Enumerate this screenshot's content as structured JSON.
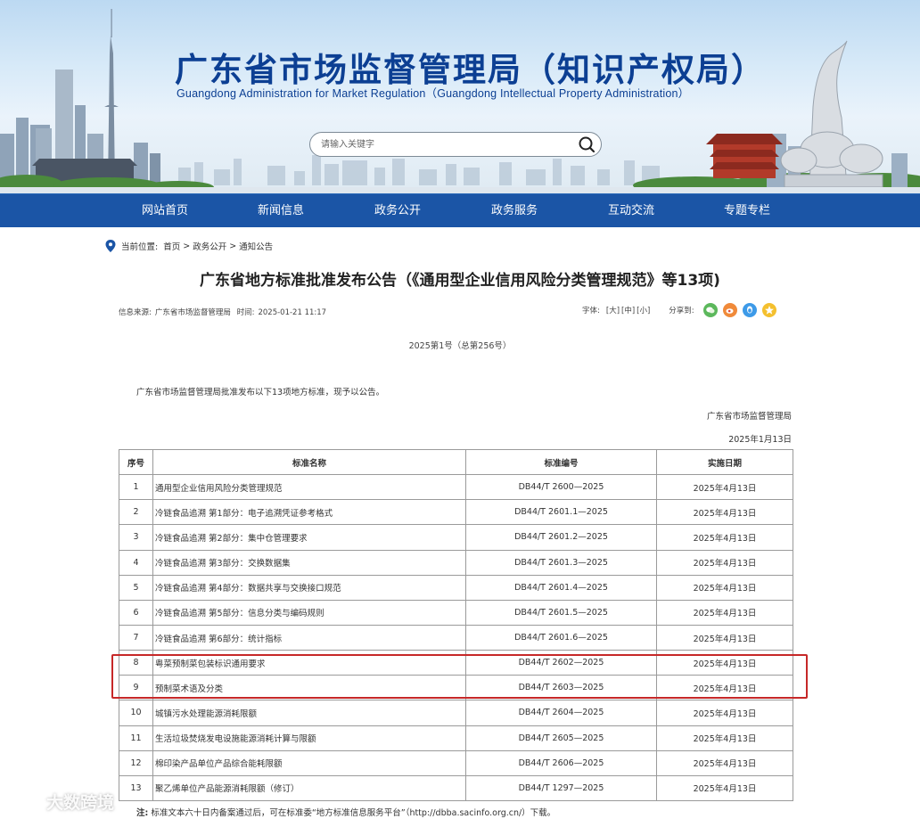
{
  "header": {
    "title": "广东省市场监督管理局（知识产权局）",
    "subtitle": "Guangdong Administration for Market Regulation（Guangdong Intellectual Property Administration）",
    "search_placeholder": "请输入关键字",
    "brand_color": "#0c3f93"
  },
  "nav": {
    "color": "#1b55a6",
    "items": [
      "网站首页",
      "新闻信息",
      "政务公开",
      "政务服务",
      "互动交流",
      "专题专栏"
    ]
  },
  "breadcrumb": {
    "label": "当前位置:",
    "items": [
      "首页",
      "政务公开",
      "通知公告"
    ],
    "separator": ">"
  },
  "article": {
    "title": "广东省地方标准批准发布公告（《通用型企业信用风险分类管理规范》等13项)",
    "source_label": "信息来源:",
    "source": "广东省市场监督管理局",
    "time_label": "时间:",
    "time": "2025-01-21 11:17",
    "font_label": "字体:",
    "font_sizes": [
      "[大]",
      "[中]",
      "[小]"
    ],
    "share_label": "分享到:",
    "share_icons": [
      "wechat-icon",
      "weibo-icon",
      "qq-icon",
      "qzone-icon"
    ],
    "doc_number": "2025第1号（总第256号）",
    "intro": "广东省市场监督管理局批准发布以下13项地方标准，现予以公告。",
    "issuer": "广东省市场监督管理局",
    "issue_date": "2025年1月13日"
  },
  "table": {
    "headers": [
      "序号",
      "标准名称",
      "标准编号",
      "实施日期"
    ],
    "rows": [
      [
        "1",
        "通用型企业信用风险分类管理规范",
        "DB44/T 2600—2025",
        "2025年4月13日"
      ],
      [
        "2",
        "冷链食品追溯 第1部分：电子追溯凭证参考格式",
        "DB44/T 2601.1—2025",
        "2025年4月13日"
      ],
      [
        "3",
        "冷链食品追溯 第2部分：集中仓管理要求",
        "DB44/T 2601.2—2025",
        "2025年4月13日"
      ],
      [
        "4",
        "冷链食品追溯 第3部分：交换数据集",
        "DB44/T 2601.3—2025",
        "2025年4月13日"
      ],
      [
        "5",
        "冷链食品追溯 第4部分：数据共享与交换接口规范",
        "DB44/T 2601.4—2025",
        "2025年4月13日"
      ],
      [
        "6",
        "冷链食品追溯 第5部分：信息分类与编码规则",
        "DB44/T 2601.5—2025",
        "2025年4月13日"
      ],
      [
        "7",
        "冷链食品追溯 第6部分：统计指标",
        "DB44/T 2601.6—2025",
        "2025年4月13日"
      ],
      [
        "8",
        "粤菜预制菜包装标识通用要求",
        "DB44/T 2602—2025",
        "2025年4月13日"
      ],
      [
        "9",
        "预制菜术语及分类",
        "DB44/T 2603—2025",
        "2025年4月13日"
      ],
      [
        "10",
        "城镇污水处理能源消耗限额",
        "DB44/T 2604—2025",
        "2025年4月13日"
      ],
      [
        "11",
        "生活垃圾焚烧发电设施能源消耗计算与限额",
        "DB44/T 2605—2025",
        "2025年4月13日"
      ],
      [
        "12",
        "棉印染产品单位产品综合能耗限额",
        "DB44/T 2606—2025",
        "2025年4月13日"
      ],
      [
        "13",
        "聚乙烯单位产品能源消耗限额（修订）",
        "DB44/T 1297—2025",
        "2025年4月13日"
      ]
    ],
    "highlighted_rows": [
      "8",
      "9"
    ],
    "highlight_color": "#c62828"
  },
  "footnote": {
    "label": "注:",
    "text": "标准文本六十日内备案通过后，可在标准委“地方标准信息服务平台”（http://dbba.sacinfo.org.cn/）下载。"
  },
  "watermark": {
    "text": "大数跨境"
  }
}
